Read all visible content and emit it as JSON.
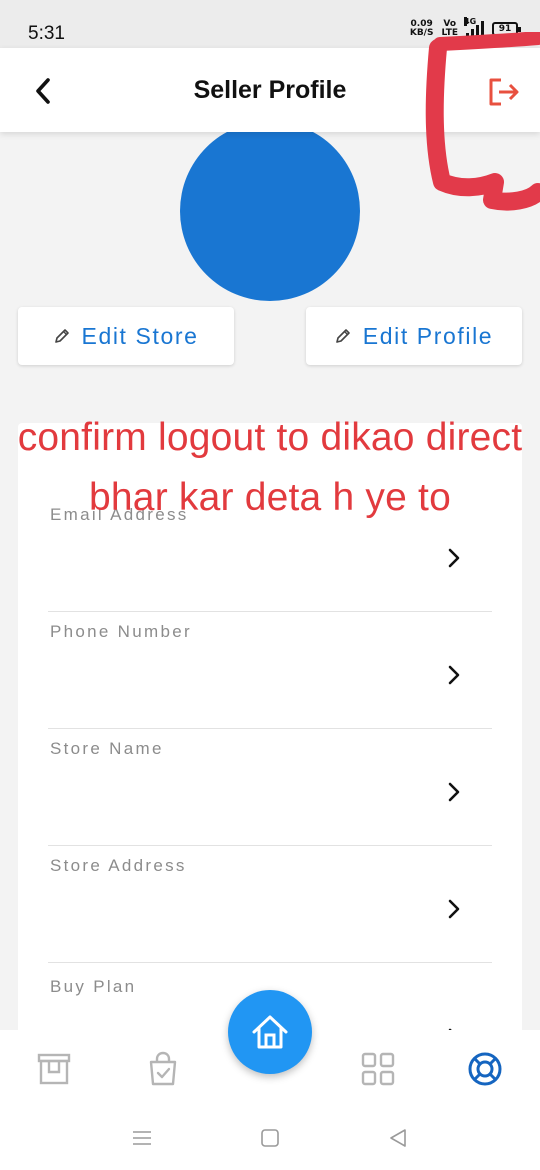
{
  "status_bar": {
    "time": "5:31",
    "net_speed_value": "0.09",
    "net_speed_unit": "KB/S",
    "volte_top": "Vo",
    "volte_bottom": "LTE",
    "network_type": "4G",
    "battery": "91"
  },
  "header": {
    "title": "Seller Profile",
    "back_icon": "chevron-left-icon",
    "logout_icon": "logout-icon"
  },
  "actions": {
    "edit_store_label": "Edit Store",
    "edit_profile_label": "Edit Profile",
    "edit_icon": "pencil-icon"
  },
  "fields": [
    {
      "label": "Email Address",
      "value": ""
    },
    {
      "label": "Phone Number",
      "value": ""
    },
    {
      "label": "Store Name",
      "value": ""
    },
    {
      "label": "Store Address",
      "value": ""
    },
    {
      "label": "Buy Plan",
      "value": ""
    }
  ],
  "annotation": {
    "text": "confirm logout to dikao direct bhar kar deta h ye to"
  },
  "bottom_nav": {
    "items": [
      "store-icon",
      "shopping-bag-check-icon",
      "home-icon",
      "grid-icon",
      "lifebuoy-icon"
    ],
    "active": "lifebuoy-icon"
  },
  "colors": {
    "accent": "#1976d2",
    "fab": "#2196f3",
    "logout": "#e8503f",
    "annotation": "#e23a3e",
    "active_nav": "#1565c0"
  }
}
